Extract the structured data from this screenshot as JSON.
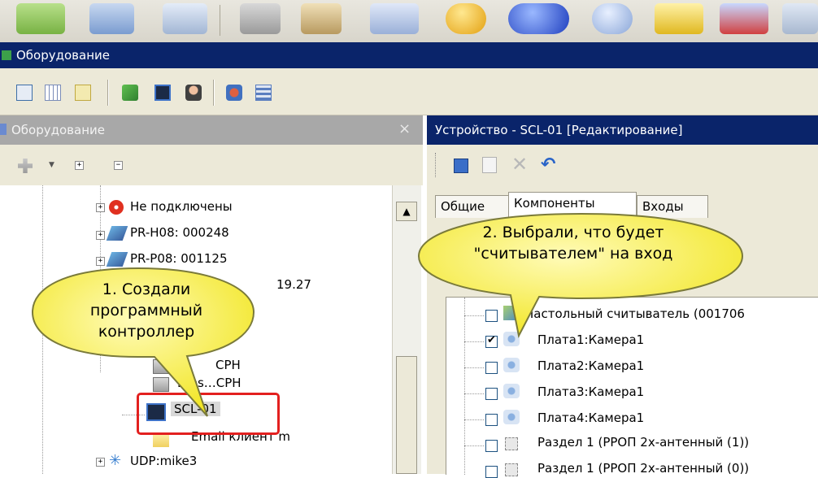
{
  "window": {
    "title": "Оборудование"
  },
  "left_panel": {
    "title": "Оборудование",
    "close_glyph": "×",
    "tree": [
      {
        "label": "Не подключены",
        "icon": "no-entry-icon"
      },
      {
        "label": "PR-H08: 000248",
        "icon": "device-icon"
      },
      {
        "label": "PR-P08: 001125",
        "icon": "device-icon"
      },
      {
        "label": "19.27",
        "icon": "network-icon"
      },
      {
        "label": "CPH",
        "icon": "controller-icon"
      },
      {
        "label": "Dies…CPH",
        "icon": "controller-icon"
      },
      {
        "label": "SCL-01",
        "icon": "software-controller-icon"
      },
      {
        "label": "Email клиент m",
        "icon": "folder-icon"
      },
      {
        "label": "UDP:mike3",
        "icon": "network-star-icon"
      }
    ]
  },
  "right_panel": {
    "title": "Устройство - SCL-01 [Редактирование]",
    "tabs": [
      "Общие",
      "Компоненты",
      "Входы"
    ],
    "items": [
      {
        "label": "Настольный считыватель (001706",
        "checked": false,
        "icon": "reader-icon"
      },
      {
        "label": "Плата1:Камера1",
        "checked": true,
        "icon": "camera-icon"
      },
      {
        "label": "Плата2:Камера1",
        "checked": false,
        "icon": "camera-icon"
      },
      {
        "label": "Плата3:Камера1",
        "checked": false,
        "icon": "camera-icon"
      },
      {
        "label": "Плата4:Камера1",
        "checked": false,
        "icon": "camera-icon"
      },
      {
        "label": "Раздел 1 (РРОП 2х-антенный (1))",
        "checked": false,
        "icon": "section-icon"
      },
      {
        "label": "Раздел 1 (РРОП 2х-антенный (0))",
        "checked": false,
        "icon": "section-icon"
      }
    ]
  },
  "callouts": {
    "first": [
      "1. Создали",
      "программный",
      "контроллер"
    ],
    "second": [
      "2. Выбрали, что будет",
      "\"считывателем\" на вход"
    ]
  },
  "colors": {
    "title_bar": "#0a246a",
    "inactive_title": "#a8a8a8",
    "balloon_fill": "#f5ef3a",
    "highlight": "#e3201f"
  }
}
